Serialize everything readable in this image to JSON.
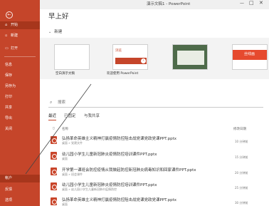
{
  "titlebar": {
    "title": "演示文稿1 - PowerPoint",
    "minimize": "—",
    "maximize": "□",
    "close": "✕"
  },
  "sidebar": {
    "back": "←",
    "items": [
      {
        "label": "开始",
        "icon": "home-icon",
        "glyph": "⌂"
      },
      {
        "label": "新建",
        "icon": "new-doc-icon",
        "glyph": "▫"
      },
      {
        "label": "打开",
        "icon": "folder-icon",
        "glyph": "▭"
      },
      {
        "label": "信息",
        "icon": "",
        "glyph": ""
      },
      {
        "label": "保存",
        "icon": "",
        "glyph": ""
      },
      {
        "label": "另存为",
        "icon": "",
        "glyph": ""
      },
      {
        "label": "打印",
        "icon": "",
        "glyph": ""
      },
      {
        "label": "共享",
        "icon": "",
        "glyph": ""
      },
      {
        "label": "导出",
        "icon": "",
        "glyph": ""
      },
      {
        "label": "关闭",
        "icon": "",
        "glyph": ""
      },
      {
        "label": "帐户",
        "icon": "",
        "glyph": ""
      },
      {
        "label": "反馈",
        "icon": "",
        "glyph": ""
      },
      {
        "label": "选项",
        "icon": "",
        "glyph": ""
      }
    ]
  },
  "main": {
    "greeting": "早上好",
    "new_section": "新建",
    "templates": [
      {
        "label": "空白演示文稿",
        "thumb_text": ""
      },
      {
        "label": "欢迎使用 PowerPoint",
        "thumb_text": "浏览",
        "accent": "#c5452a"
      },
      {
        "label": "",
        "thumb_text": "",
        "accent": "#4e6b4a"
      },
      {
        "label": "",
        "thumb_text": "丝线画",
        "accent": "#e64a2e"
      }
    ],
    "search_placeholder": "搜索",
    "tabs": [
      "最近",
      "已固定",
      "与我共享"
    ],
    "columns": {
      "name": "名称",
      "modified": "修改日期"
    },
    "files": [
      {
        "name": "弘扬革命英雄主义精神打赢疫情防控阻击战党课党政党课PPT.pptx",
        "path": "桌面 » 党建文件",
        "date": "10 分钟前"
      },
      {
        "name": "幼儿园小学生儿童新冠肺炎疫情防控培训课件PPT.pptx",
        "path": "桌面",
        "date": "15 分钟前"
      },
      {
        "name": "开学第一课班会防控疫情从我做起防控新冠肺炎病毒知识和回家课件PPT.pptx",
        "path": "桌面 » 班会课件",
        "date": "20 分钟前"
      },
      {
        "name": "幼儿园小学生儿童新冠肺炎疫情防控培训课件PPT.pptx",
        "path": "桌面 » 幼儿园小学生儿童新冠肺炎疫情防控",
        "date": "25 分钟前"
      },
      {
        "name": "弘扬革命英雄主义精神打赢疫情防控阻击战党课党政党课PPT.pptx",
        "path": "桌面",
        "date": "30 分钟前"
      }
    ]
  },
  "colors": {
    "brand": "#c5452a",
    "active": "#a7361c"
  }
}
